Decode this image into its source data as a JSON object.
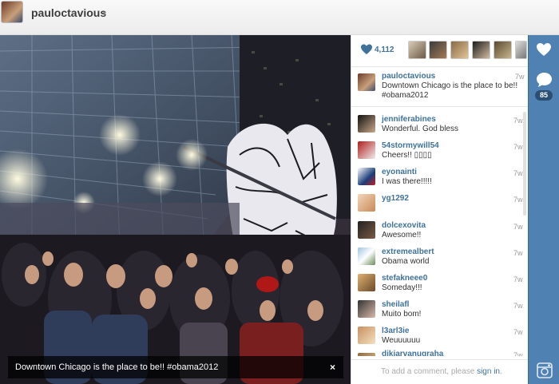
{
  "header": {
    "username": "pauloctavious",
    "caret": "▾"
  },
  "photo": {
    "caption": "Downtown Chicago is the place to be!! #obama2012",
    "close": "×"
  },
  "likes": {
    "count": "4,112"
  },
  "post": {
    "username": "pauloctavious",
    "time": "7w",
    "text_line1": "Downtown Chicago is the place to be!!",
    "text_line2": "#obama2012"
  },
  "comments": [
    {
      "user": "jenniferabines",
      "text": "Wonderful. God bless",
      "time": "7w"
    },
    {
      "user": "54stormywill54",
      "text": "Cheers!! ▯▯▯▯",
      "time": "7w"
    },
    {
      "user": "eyonainti",
      "text": "I was there!!!!!",
      "time": "7w"
    },
    {
      "user": "yg1292",
      "text": "",
      "time": "7w"
    },
    {
      "user": "dolcexovita",
      "text": "Awesome!!",
      "time": "7w"
    },
    {
      "user": "extremealbert",
      "text": "Obama world",
      "time": "7w"
    },
    {
      "user": "stefakneee0",
      "text": "Someday!!!",
      "time": "7w"
    },
    {
      "user": "sheilafl",
      "text": "Muito bom!",
      "time": "7w"
    },
    {
      "user": "l3arl3ie",
      "text": "Weuuuuuu",
      "time": "7w"
    },
    {
      "user": "dikiarvanugraha",
      "text": "",
      "time": "7w"
    }
  ],
  "comment_input": {
    "prefix": "To add a comment, please ",
    "link": "sign in",
    "suffix": "."
  },
  "sidebar": {
    "comment_count": "85"
  },
  "colors": {
    "link": "#3f729b",
    "sidebar": "#4f81b3",
    "badge": "#2b4f73"
  }
}
